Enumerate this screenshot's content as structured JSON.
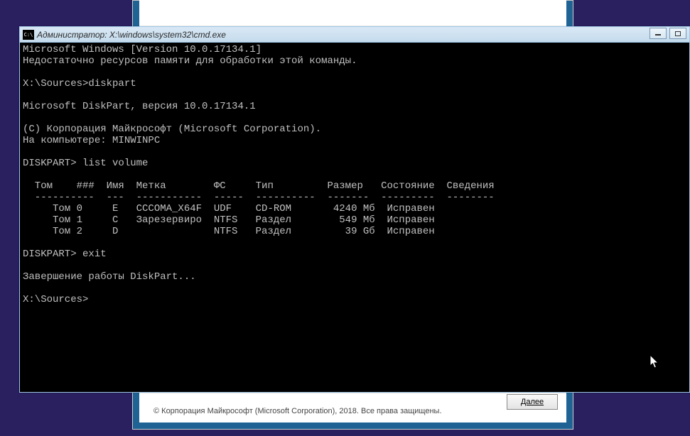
{
  "window": {
    "title": "Администратор: X:\\windows\\system32\\cmd.exe"
  },
  "terminal": {
    "lines": [
      "Microsoft Windows [Version 10.0.17134.1]",
      "Недостаточно ресурсов памяти для обработки этой команды.",
      "",
      "X:\\Sources>diskpart",
      "",
      "Microsoft DiskPart, версия 10.0.17134.1",
      "",
      "(C) Корпорация Майкрософт (Microsoft Corporation).",
      "На компьютере: MINWINPC",
      "",
      "DISKPART> list volume",
      "",
      "  Том    ###  Имя  Метка        ФС     Тип         Размер   Состояние  Сведения",
      "  ----------  ---  -----------  -----  ----------  -------  ---------  --------",
      "     Том 0     E   CCCOMA_X64F  UDF    CD-ROM       4240 Мб  Исправен",
      "     Том 1     C   Зарезервиро  NTFS   Раздел        549 Мб  Исправен",
      "     Том 2     D                NTFS   Раздел         39 Gб  Исправен",
      "",
      "DISKPART> exit",
      "",
      "Завершение работы DiskPart...",
      "",
      "X:\\Sources>"
    ]
  },
  "footer": {
    "copyright": "© Корпорация Майкрософт (Microsoft Corporation), 2018. Все права защищены.",
    "next_button": "Далее"
  }
}
